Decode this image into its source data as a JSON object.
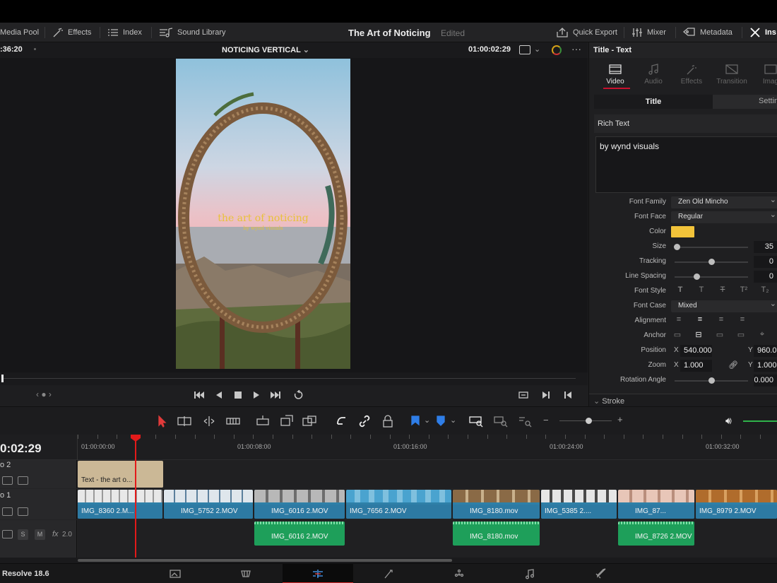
{
  "toolbar": {
    "media_pool": "Media Pool",
    "effects": "Effects",
    "index": "Index",
    "sound_library": "Sound Library",
    "project_title": "The Art of Noticing",
    "project_status": "Edited",
    "quick_export": "Quick Export",
    "mixer": "Mixer",
    "metadata": "Metadata",
    "inspector": "Ins"
  },
  "viewer": {
    "left_timecode": ":36:20",
    "timeline_name": "NOTICING VERTICAL",
    "right_timecode": "01:00:02:29",
    "title_overlay": "the art of noticing",
    "subtitle_overlay": "by wynd visuals"
  },
  "inspector": {
    "header": "Title - Text",
    "tabs": [
      "Video",
      "Audio",
      "Effects",
      "Transition",
      "Imag"
    ],
    "subtabs": [
      "Title",
      "Settin"
    ],
    "rich_text_label": "Rich Text",
    "rich_text_value": "by wynd visuals",
    "font_family_label": "Font Family",
    "font_family": "Zen Old Mincho",
    "font_face_label": "Font Face",
    "font_face": "Regular",
    "color_label": "Color",
    "color_value": "#f2c33a",
    "size_label": "Size",
    "size": "35",
    "size_level": 0.03,
    "tracking_label": "Tracking",
    "tracking": "0",
    "tracking_level": 0.5,
    "line_spacing_label": "Line Spacing",
    "line_spacing": "0",
    "line_spacing_level": 0.3,
    "font_style_label": "Font Style",
    "font_case_label": "Font Case",
    "font_case": "Mixed",
    "alignment_label": "Alignment",
    "anchor_label": "Anchor",
    "position_label": "Position",
    "pos_x_label": "X",
    "pos_x": "540.000",
    "pos_y_label": "Y",
    "pos_y": "960.0",
    "zoom_label": "Zoom",
    "zoom_x_label": "X",
    "zoom_x": "1.000",
    "zoom_y_label": "Y",
    "zoom_y": "1.000",
    "rotation_label": "Rotation Angle",
    "rotation": "0.000",
    "rotation_level": 0.5,
    "stroke_label": "Stroke"
  },
  "timeline": {
    "timecode": "0:02:29",
    "ruler": [
      "01:00:00:00",
      "01:00:08:00",
      "01:00:16:00",
      "01:00:24:00",
      "01:00:32:00"
    ],
    "track_v2_label": "o 2",
    "track_v1_label": "o 1",
    "audio_buttons": [
      "S",
      "M"
    ],
    "audio_fx": "fx",
    "audio_level": "2.0",
    "title_clip": "Text - the art o...",
    "video_clips": [
      "IMG_8360 2.M...",
      "IMG_5752 2.MOV",
      "IMG_6016 2.MOV",
      "IMG_7656 2.MOV",
      "IMG_8180.mov",
      "IMG_5385 2....",
      "IMG_87...",
      "IMG_8979 2.MOV"
    ],
    "audio_clips": [
      "IMG_6016 2.MOV",
      "IMG_8180.mov",
      "IMG_8726 2.MOV"
    ]
  },
  "footer": {
    "version": "Resolve 18.6"
  }
}
